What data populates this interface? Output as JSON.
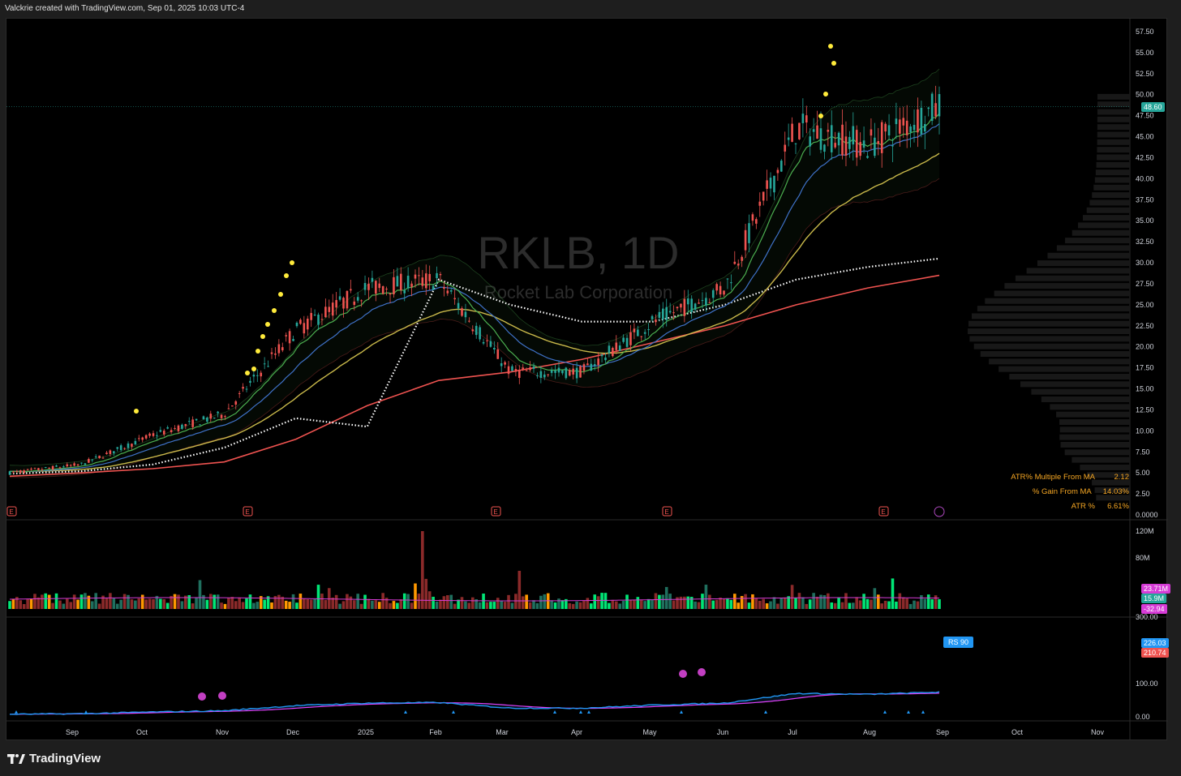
{
  "header": {
    "text": "Valckrie created with TradingView.com, Sep 01, 2025 10:03 UTC-4"
  },
  "watermark": {
    "symbol": "RKLB, 1D",
    "name": "Rocket Lab Corporation"
  },
  "footer": {
    "brand": "TradingView"
  },
  "price_axis": {
    "ticks": [
      "57.50",
      "55.00",
      "52.50",
      "50.00",
      "47.50",
      "45.00",
      "42.50",
      "40.00",
      "37.50",
      "35.00",
      "32.50",
      "30.00",
      "27.50",
      "25.00",
      "22.50",
      "20.00",
      "17.50",
      "15.00",
      "12.50",
      "10.00",
      "7.50",
      "5.00",
      "2.50",
      "0.0000"
    ],
    "last_price": "48.60"
  },
  "volume_axis": {
    "ticks": [
      "120M",
      "80M"
    ],
    "badges": [
      {
        "text": "23.71M",
        "color": "#d63bd6"
      },
      {
        "text": "15.9M",
        "color": "#26a69a"
      },
      {
        "text": "-32.94",
        "color": "#d63bd6"
      }
    ]
  },
  "rs_axis": {
    "ticks": [
      "300.00",
      "100.00",
      "0.00"
    ],
    "badges": [
      {
        "text": "226.03",
        "color": "#2196f3"
      },
      {
        "text": "210.74",
        "color": "#ef5350"
      }
    ],
    "label": "RS 90"
  },
  "time_axis": {
    "labels": [
      "Sep",
      "Oct",
      "Nov",
      "Dec",
      "2025",
      "Feb",
      "Mar",
      "Apr",
      "May",
      "Jun",
      "Jul",
      "Aug",
      "Sep",
      "Oct",
      "Nov"
    ]
  },
  "stats_table": [
    {
      "label": "ATR% Multiple From MA",
      "value": "2.12"
    },
    {
      "label": "% Gain From MA",
      "value": "14.03%"
    },
    {
      "label": "ATR %",
      "value": "6.61%"
    }
  ],
  "earnings_marker": "E",
  "colors": {
    "up": "#26a69a",
    "down": "#ef5350",
    "bright_up": "#00e676",
    "ema200": "#ef5350",
    "ema50": "#c8b84a",
    "ema10": "#4caf50",
    "ema21": "#3f72c8",
    "dots": "#ffeb3b",
    "rs_line": "#2196f3",
    "rs_ma": "#e040fb"
  },
  "chart_data": {
    "type": "line",
    "title": "RKLB, 1D",
    "subtitle": "Rocket Lab Corporation",
    "ylim": [
      0,
      57.5
    ],
    "x": [
      "Aug",
      "Sep",
      "Oct",
      "Nov",
      "Dec",
      "2025",
      "Feb",
      "Mar",
      "Apr",
      "May",
      "Jun",
      "Jul",
      "Aug",
      "Sep"
    ],
    "series": [
      {
        "name": "Close",
        "values": [
          5.0,
          6.0,
          9.5,
          12,
          22,
          27,
          28,
          17,
          17,
          23,
          27,
          46,
          44,
          48.6
        ]
      },
      {
        "name": "",
        "values": [
          4.6,
          5.0,
          5.5,
          6.3,
          9.0,
          13.0,
          16.0,
          17.0,
          18.5,
          20.5,
          22.5,
          25.0,
          27.0,
          28.5
        ]
      },
      {
        "name": "",
        "values": [
          4.9,
          5.2,
          6.0,
          8.0,
          11.5,
          10.5,
          28.0,
          25.0,
          23.0,
          23.0,
          25.0,
          28.0,
          29.5,
          30.5
        ]
      }
    ],
    "volume_last": "23.71M",
    "rs_last": 226.03,
    "rs_ma_last": 210.74
  }
}
